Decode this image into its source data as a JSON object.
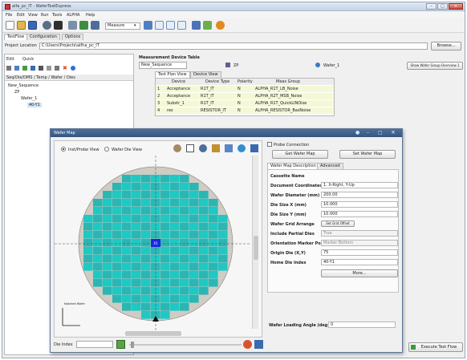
{
  "window": {
    "title": "alfa_pc_IT - WaferTestExpress"
  },
  "menu": [
    "File",
    "Edit",
    "View",
    "Run",
    "Tools",
    "ALPHA",
    "Help"
  ],
  "toolbar": {
    "measure_select": "Measure"
  },
  "tabs": [
    "TestFlow",
    "Configuration",
    "Options"
  ],
  "project": {
    "label": "Project Location",
    "path": "C:\\Users\\Projects\\alfha_pc_IT",
    "browse": "Browse..."
  },
  "left_panel": {
    "toolbar_label": "Edit",
    "toolbar_label2": "Quick",
    "path_header": "Seq/Die/DMS / Temp / Wafer / Dies",
    "tree": [
      "New_Sequence",
      "ZP",
      "Wafer_1",
      "40-Y1"
    ]
  },
  "measurement": {
    "header": "Measurement Device Table",
    "sequence": "New_Sequence",
    "device_field": "ZP",
    "wafer_field": "Wafer_1",
    "show_btn": "Show Wafer Group Overview 1",
    "view_tabs": [
      "Test Plan View",
      "Device View"
    ],
    "columns": [
      "Device",
      "Device Type",
      "Polarity",
      "Meas Group"
    ],
    "rows": [
      [
        "1",
        "Acceptance",
        "R1T_IT",
        "N",
        "ALPHA_R1T_LB_Noise"
      ],
      [
        "2",
        "Acceptance",
        "R1T_IT",
        "N",
        "ALPHA_R2T_MSB_Noise"
      ],
      [
        "3",
        "Substr_1",
        "R1T_IT",
        "N",
        "ALPHA_R1T_QuickLINOise"
      ],
      [
        "4",
        "res",
        "RESISTOR_IT",
        "N",
        "ALPHA_RESISTOR_BasNoise"
      ]
    ]
  },
  "wafer_map": {
    "title": "Wafer Map",
    "view_radio_1": "Inst/Probe View",
    "view_radio_2": "Wafer Die View",
    "notch_label": "Notched Wafer",
    "die_index_label": "Die Index",
    "selected_die": "X1",
    "probe_connection_label": "Probe Connection",
    "get_map_btn": "Get Wafer Map",
    "set_map_btn": "Set Wafer Map",
    "desc_tabs": [
      "Wafer Map Description",
      "Advanced"
    ],
    "fields": [
      {
        "label": "Cassette Name",
        "value": ""
      },
      {
        "label": "Document Coordinates",
        "value": "1. X-Right, Y-Up"
      },
      {
        "label": "Wafer Diameter (mm)",
        "value": "200.00"
      },
      {
        "label": "Die Size X (mm)",
        "value": "10.000"
      },
      {
        "label": "Die Size Y (mm)",
        "value": "10.000"
      },
      {
        "label": "Wafer Grid Arrange",
        "value": "Set Grid Offset"
      },
      {
        "label": "Include Partial Dies",
        "value": "True"
      },
      {
        "label": "Orientation Marker Pos",
        "value": "Marker Bottom"
      },
      {
        "label": "Origin Die (X,Y)",
        "value": "75"
      },
      {
        "label": "Home Die Index",
        "value": "40-Y1"
      }
    ],
    "more_btn": "More...",
    "loading_angle_label": "Wafer Loading Angle (deg)",
    "loading_angle_value": "0"
  },
  "footer": {
    "button": "Execute Test Flow"
  },
  "colors": {
    "die": "#1ec9c4",
    "die_alt": "#2bb6b4",
    "wafer_bg": "#cfccc4",
    "selected_die": "#1a28e0"
  }
}
